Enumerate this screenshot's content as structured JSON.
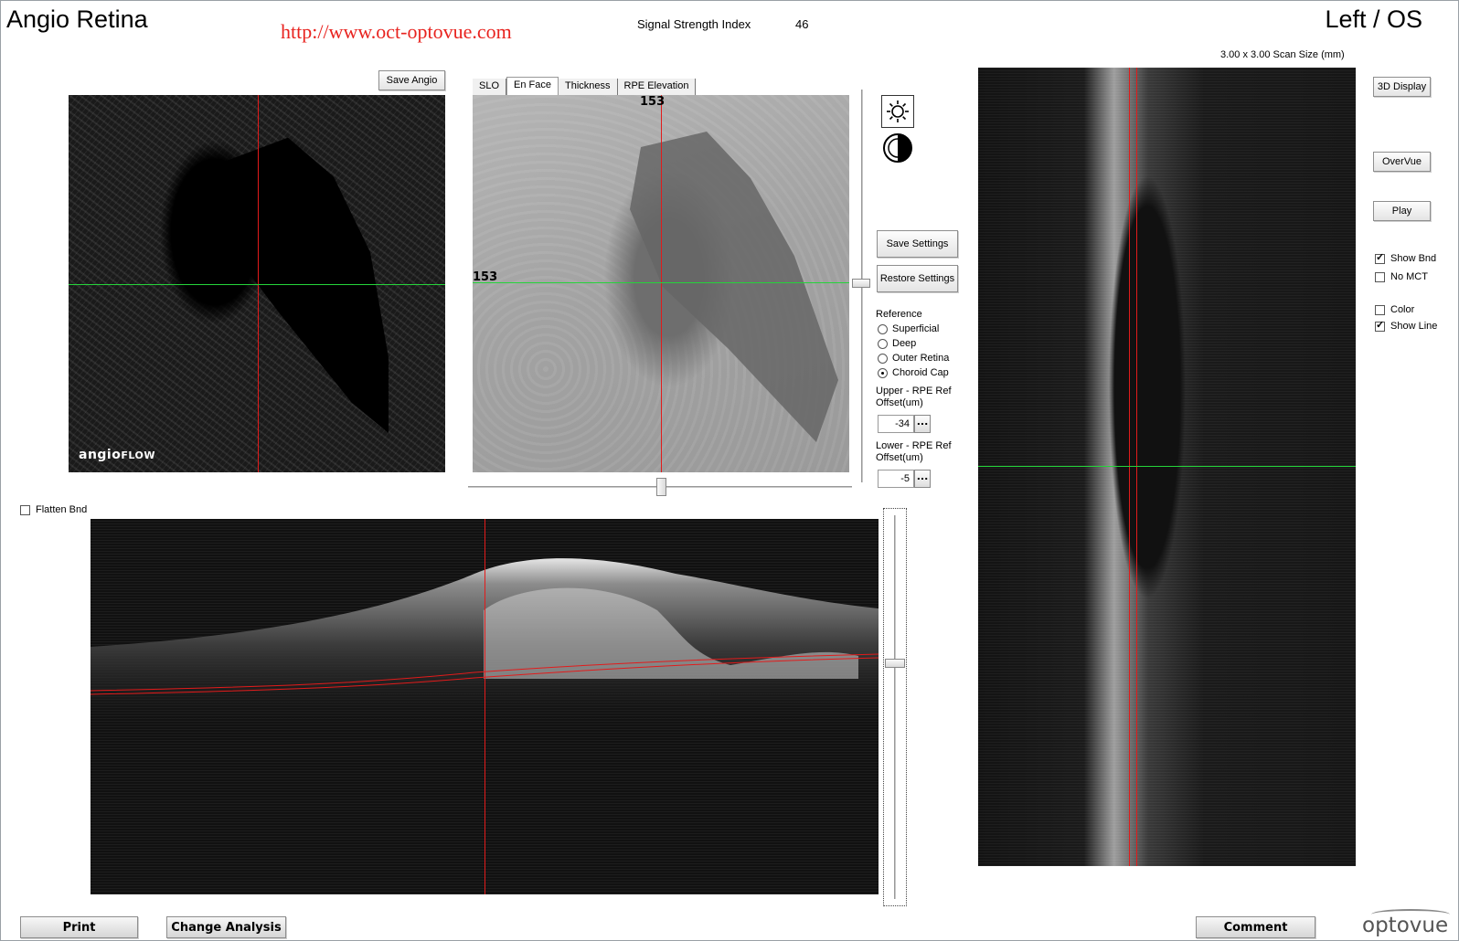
{
  "header": {
    "title": "Angio Retina",
    "watermark": "http://www.oct-optovue.com",
    "signal_strength_label": "Signal Strength Index",
    "signal_strength_value": "46",
    "eye": "Left / OS",
    "scan_size": "3.00 x 3.00 Scan Size (mm)"
  },
  "angio_panel": {
    "save_label": "Save Angio",
    "logo_main": "angio",
    "logo_suffix": "FLOW"
  },
  "enface_panel": {
    "tabs": [
      {
        "label": "SLO"
      },
      {
        "label": "En Face"
      },
      {
        "label": "Thickness"
      },
      {
        "label": "RPE Elevation"
      }
    ],
    "active_tab": "En Face",
    "top_marker": "153",
    "left_marker": "153"
  },
  "controls": {
    "save_settings": "Save Settings",
    "restore_settings": "Restore Settings",
    "reference_label": "Reference",
    "references": [
      {
        "label": "Superficial",
        "selected": false
      },
      {
        "label": "Deep",
        "selected": false
      },
      {
        "label": "Outer Retina",
        "selected": false
      },
      {
        "label": "Choroid Cap",
        "selected": true
      }
    ],
    "upper_label_1": "Upper - RPE Ref",
    "upper_label_2": "Offset(um)",
    "upper_value": "-34",
    "lower_label_1": "Lower - RPE Ref",
    "lower_label_2": "Offset(um)",
    "lower_value": "-5",
    "dots": "..."
  },
  "right_panel": {
    "display_3d": "3D Display",
    "overvue": "OverVue",
    "play": "Play",
    "show_bnd": "Show Bnd",
    "no_mct": "No MCT",
    "color": "Color",
    "show_line": "Show Line"
  },
  "bscan_panel": {
    "flatten_bnd": "Flatten Bnd"
  },
  "footer": {
    "print": "Print",
    "change_analysis": "Change Analysis",
    "comment": "Comment",
    "logo": "optovue"
  },
  "colors": {
    "crosshair_vertical": "#e21b1b",
    "crosshair_horizontal": "#25d43a",
    "watermark": "#e8231f"
  }
}
